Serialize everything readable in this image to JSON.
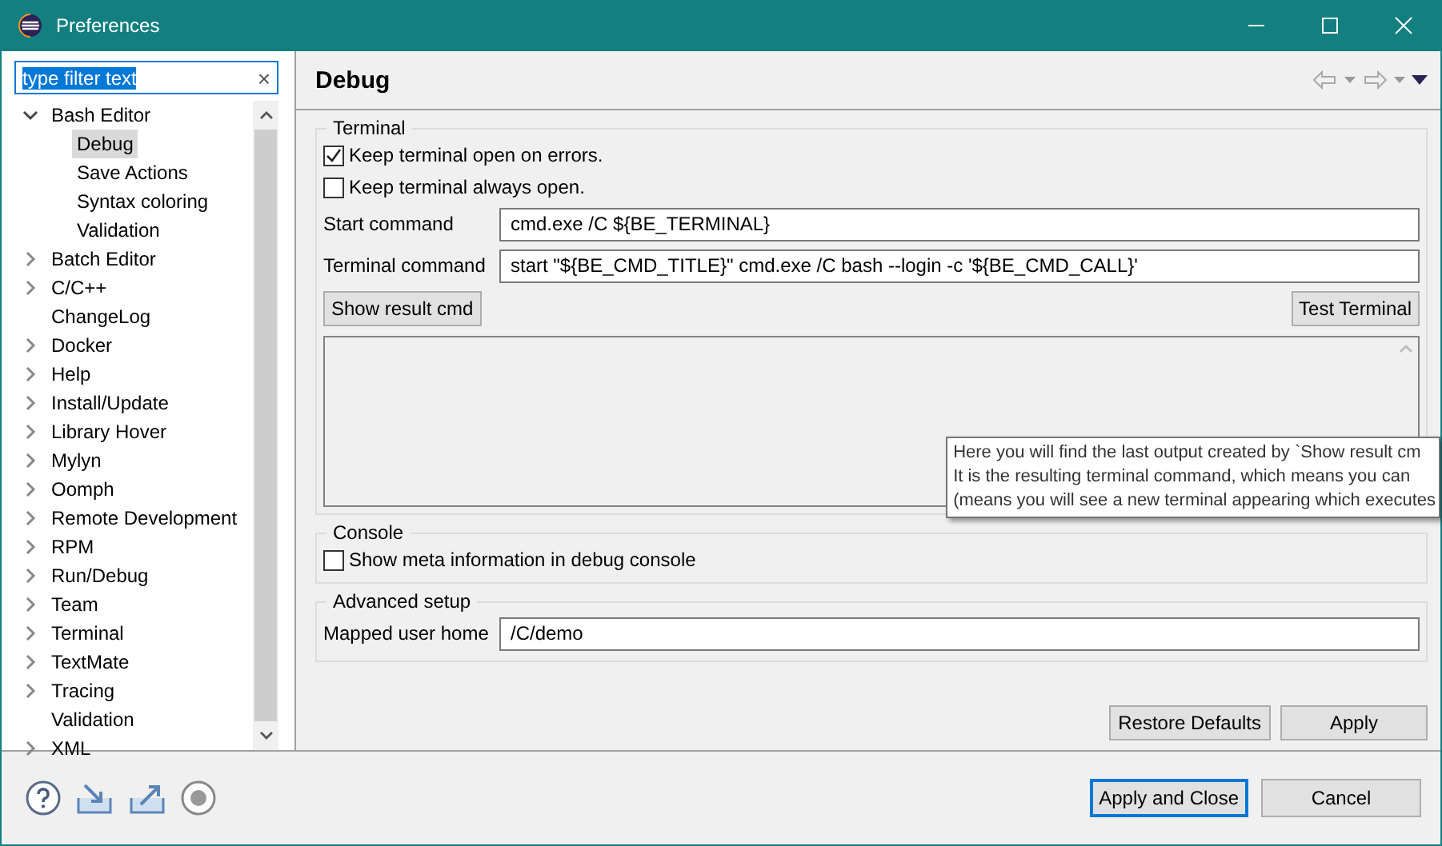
{
  "window": {
    "title": "Preferences"
  },
  "filter": {
    "value": "type filter text",
    "clear_glyph": "×"
  },
  "tree": [
    {
      "label": "Bash Editor",
      "kind": "group",
      "expanded": true,
      "selected": false,
      "children": [
        {
          "label": "Debug",
          "selected": true
        },
        {
          "label": "Save Actions",
          "selected": false
        },
        {
          "label": "Syntax coloring",
          "selected": false
        },
        {
          "label": "Validation",
          "selected": false
        }
      ]
    },
    {
      "label": "Batch Editor",
      "kind": "group",
      "expanded": false,
      "selected": false
    },
    {
      "label": "C/C++",
      "kind": "group",
      "expanded": false,
      "selected": false
    },
    {
      "label": "ChangeLog",
      "kind": "leaf",
      "selected": false
    },
    {
      "label": "Docker",
      "kind": "group",
      "expanded": false,
      "selected": false
    },
    {
      "label": "Help",
      "kind": "group",
      "expanded": false,
      "selected": false
    },
    {
      "label": "Install/Update",
      "kind": "group",
      "expanded": false,
      "selected": false
    },
    {
      "label": "Library Hover",
      "kind": "group",
      "expanded": false,
      "selected": false
    },
    {
      "label": "Mylyn",
      "kind": "group",
      "expanded": false,
      "selected": false
    },
    {
      "label": "Oomph",
      "kind": "group",
      "expanded": false,
      "selected": false
    },
    {
      "label": "Remote Development",
      "kind": "group",
      "expanded": false,
      "selected": false
    },
    {
      "label": "RPM",
      "kind": "group",
      "expanded": false,
      "selected": false
    },
    {
      "label": "Run/Debug",
      "kind": "group",
      "expanded": false,
      "selected": false
    },
    {
      "label": "Team",
      "kind": "group",
      "expanded": false,
      "selected": false
    },
    {
      "label": "Terminal",
      "kind": "group",
      "expanded": false,
      "selected": false
    },
    {
      "label": "TextMate",
      "kind": "group",
      "expanded": false,
      "selected": false
    },
    {
      "label": "Tracing",
      "kind": "group",
      "expanded": false,
      "selected": false
    },
    {
      "label": "Validation",
      "kind": "leaf",
      "selected": false
    },
    {
      "label": "XML",
      "kind": "group",
      "expanded": false,
      "selected": false
    }
  ],
  "page": {
    "title": "Debug",
    "terminal": {
      "title": "Terminal",
      "checkboxes": [
        {
          "label": "Keep terminal open on errors.",
          "checked": true
        },
        {
          "label": "Keep terminal always open.",
          "checked": false
        }
      ],
      "fields": [
        {
          "label": "Start command",
          "value": "cmd.exe /C ${BE_TERMINAL}"
        },
        {
          "label": "Terminal command",
          "value": "start \"${BE_CMD_TITLE}\" cmd.exe /C bash --login -c '${BE_CMD_CALL}'"
        }
      ],
      "show_button": "Show result cmd",
      "test_button": "Test Terminal"
    },
    "tooltip": [
      "Here you will find the last output created by `Show result cm",
      "It is the resulting terminal command, which means you can",
      "(means you will see a new terminal appearing which executes"
    ],
    "console": {
      "title": "Console",
      "checkboxes": [
        {
          "label": "Show meta information in debug console",
          "checked": false
        }
      ]
    },
    "advanced": {
      "title": "Advanced setup",
      "fields": [
        {
          "label": "Mapped user home",
          "value": "/C/demo"
        }
      ]
    },
    "buttons": [
      "Restore Defaults",
      "Apply"
    ]
  },
  "footer_buttons": [
    {
      "label": "Apply and Close",
      "default": true
    },
    {
      "label": "Cancel",
      "default": false
    }
  ]
}
